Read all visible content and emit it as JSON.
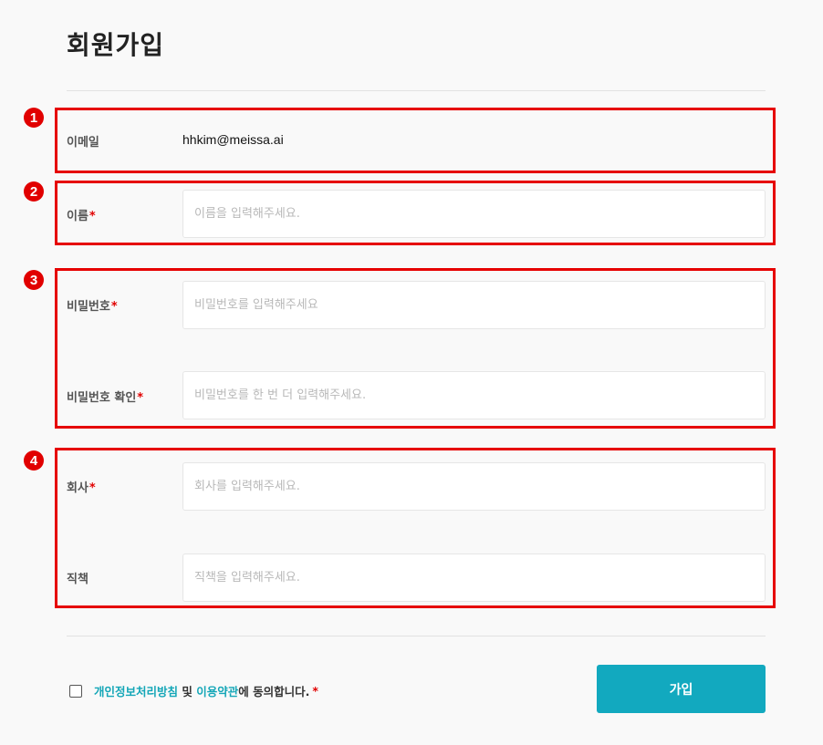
{
  "page": {
    "title": "회원가입"
  },
  "badges": [
    "1",
    "2",
    "3",
    "4"
  ],
  "fields": {
    "email": {
      "label": "이메일",
      "value": "hhkim@meissa.ai"
    },
    "name": {
      "label": "이름",
      "required_mark": "*",
      "placeholder": "이름을 입력해주세요."
    },
    "password": {
      "label": "비밀번호",
      "required_mark": "*",
      "placeholder": "비밀번호를 입력해주세요"
    },
    "password_confirm": {
      "label": "비밀번호 확인",
      "required_mark": "*",
      "placeholder": "비밀번호를 한 번 더 입력해주세요."
    },
    "company": {
      "label": "회사",
      "required_mark": "*",
      "placeholder": "회사를 입력해주세요."
    },
    "position": {
      "label": "직책",
      "placeholder": "직책을 입력해주세요."
    }
  },
  "agreement": {
    "privacy_link": "개인정보처리방침",
    "conjunction": " 및 ",
    "terms_link": "이용약관",
    "suffix": "에 동의합니다.",
    "required_mark": "*"
  },
  "submit": {
    "label": "가입"
  },
  "colors": {
    "accent": "#12a9bf",
    "link": "#13a6b7",
    "highlight": "#e60000",
    "required": "#e10000"
  }
}
